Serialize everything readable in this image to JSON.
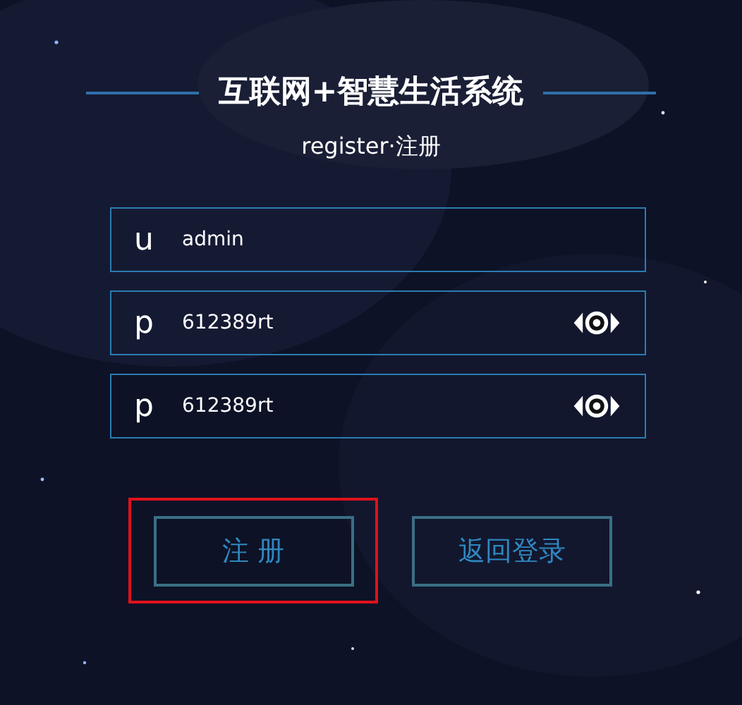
{
  "title": "互联网+智慧生活系统",
  "subtitle": "register·注册",
  "fields": [
    {
      "prefix": "u",
      "value": "admin",
      "kind": "text"
    },
    {
      "prefix": "p",
      "value": "612389rt",
      "kind": "password"
    },
    {
      "prefix": "p",
      "value": "612389rt",
      "kind": "password"
    }
  ],
  "buttons": [
    {
      "label": "注 册",
      "highlighted": true
    },
    {
      "label": "返回登录",
      "highlighted": false
    }
  ]
}
